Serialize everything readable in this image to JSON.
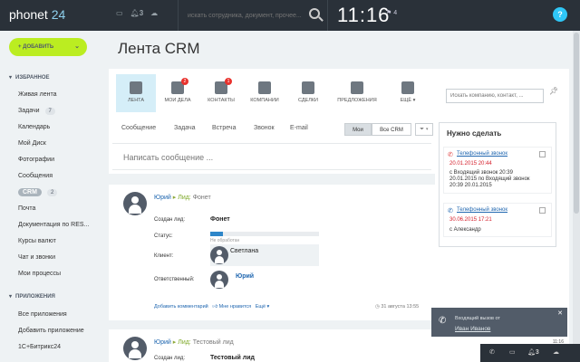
{
  "top": {
    "logo_text": "phonet",
    "logo_num": "24",
    "bell_count": "3",
    "search_placeholder": "искать сотрудника, документ, прочее...",
    "time": "11:16",
    "flag_count": "4",
    "help": "?"
  },
  "sidebar": {
    "add_label": "ДОБАВИТЬ",
    "favorites_title": "ИЗБРАННОЕ",
    "items": [
      {
        "label": "Живая лента"
      },
      {
        "label": "Задачи",
        "count": "7"
      },
      {
        "label": "Календарь"
      },
      {
        "label": "Мой Диск"
      },
      {
        "label": "Фотографии"
      },
      {
        "label": "Сообщения"
      },
      {
        "label": "CRM",
        "count": "2"
      },
      {
        "label": "Почта"
      },
      {
        "label": "Документация по RES..."
      },
      {
        "label": "Курсы валют"
      },
      {
        "label": "Чат и звонки"
      },
      {
        "label": "Мои процессы"
      }
    ],
    "apps_title": "ПРИЛОЖЕНИЯ",
    "apps": [
      {
        "label": "Все приложения"
      },
      {
        "label": "Добавить приложение"
      },
      {
        "label": "1С+Битрикс24"
      }
    ]
  },
  "main": {
    "title": "Лента CRM",
    "nav": [
      {
        "label": "ЛЕНТА",
        "icon": "feed-icon"
      },
      {
        "label": "МОИ ДЕЛА",
        "icon": "tasks-icon",
        "badge": "2"
      },
      {
        "label": "КОНТАКТЫ",
        "icon": "contacts-icon",
        "badge": "1"
      },
      {
        "label": "КОМПАНИИ",
        "icon": "companies-icon"
      },
      {
        "label": "СДЕЛКИ",
        "icon": "deals-icon"
      },
      {
        "label": "ПРЕДЛОЖЕНИЯ",
        "icon": "offers-icon"
      },
      {
        "label": "ЕЩЁ",
        "icon": "more-icon"
      }
    ],
    "crm_search_placeholder": "Искать компанию, контакт, ...",
    "compose_tabs": [
      "Сообщение",
      "Задача",
      "Встреча",
      "Звонок",
      "E-mail"
    ],
    "filter_my": "Мои",
    "filter_all": "Все CRM",
    "write_placeholder": "Написать сообщение ..."
  },
  "post1": {
    "author": "Юрий",
    "lead_label": "Лид:",
    "lead_name": "Фонет",
    "created_label": "Создан лид:",
    "created_value": "Фонет",
    "status_label": "Статус:",
    "status_value": "Не обработан",
    "status_progress": 0.12,
    "client_label": "Клиент:",
    "client_name": "Светлана",
    "responsible_label": "Ответственный:",
    "responsible_name": "Юрий",
    "add_comment": "Добавить комментарий",
    "like": "Мне нравится",
    "more": "Ещё",
    "date": "31 августа 13:55"
  },
  "post2": {
    "author": "Юрий",
    "lead_label": "Лид:",
    "lead_name": "Тестовый лид",
    "created_label": "Создан лид:",
    "created_value": "Тестовый лид"
  },
  "todo": {
    "title": "Нужно сделать",
    "items": [
      {
        "title": "Телефонный звонок",
        "date": "20.01.2015 20:44",
        "lines": [
          "с Входящий звонок 20:39",
          "20.01.2015 по Входящий звонок",
          "20:39 20.01.2015"
        ]
      },
      {
        "title": "Телефонный звонок",
        "date": "30.06.2015 17:21",
        "lines": [
          "с Александр"
        ]
      }
    ]
  },
  "notification": {
    "line1": "Входящий вызов от",
    "line2": "Иван Иванов",
    "time": "11:16"
  },
  "bottom": {
    "bell_count": "3"
  },
  "colors": {
    "topbar": "#2a3139",
    "accent_green": "#bbed21",
    "link_blue": "#2067b0",
    "active_tab": "#d5eef8",
    "alert_red": "#d5202d"
  }
}
